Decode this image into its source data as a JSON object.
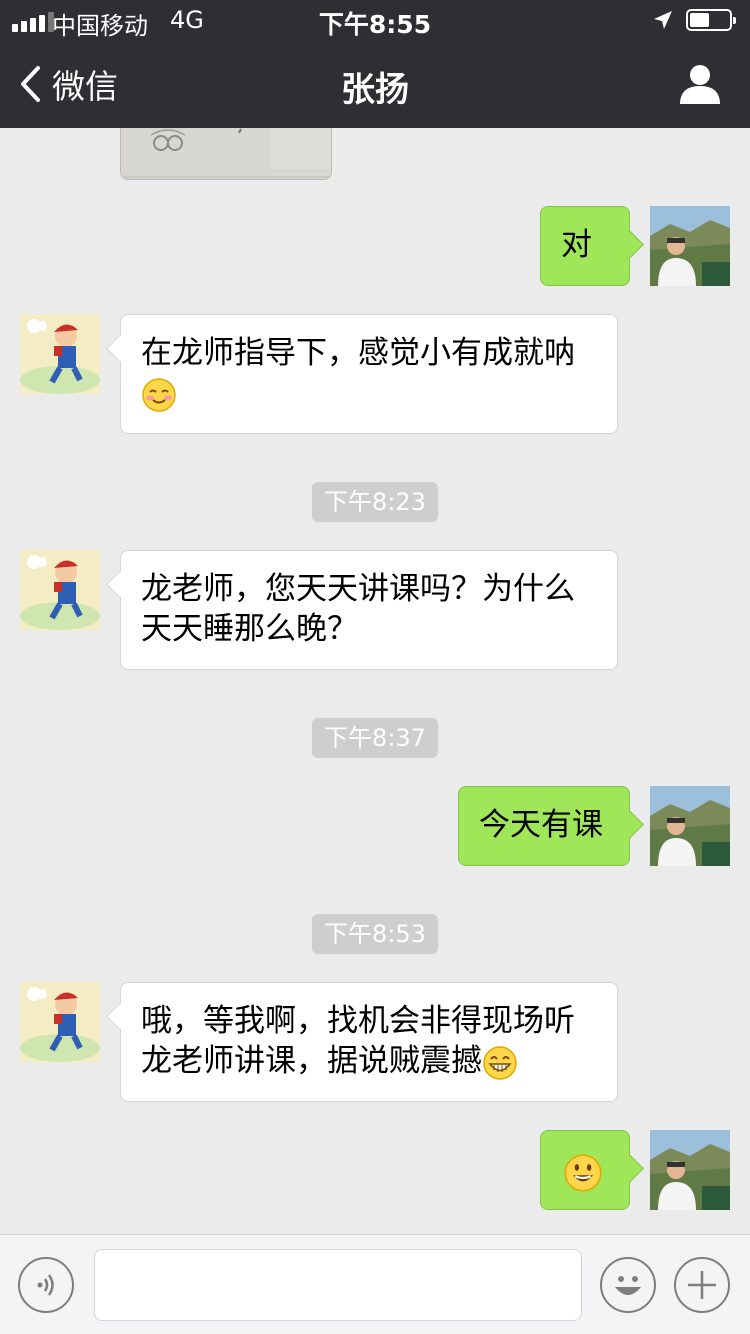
{
  "status_bar": {
    "carrier": "中国移动",
    "network": "4G",
    "time": "下午8:55",
    "battery_level": 0.5,
    "signal_bars": 4
  },
  "nav": {
    "back_label": "微信",
    "title": "张扬",
    "back_icon": "chevron-left-icon",
    "profile_icon": "person-icon"
  },
  "colors": {
    "header_bg": "#2e2e33",
    "chat_bg": "#ebebeb",
    "sent_bubble": "#9fe658",
    "received_bubble": "#ffffff",
    "timestamp_bg": "#cecece"
  },
  "messages": [
    {
      "type": "image",
      "sender": "contact"
    },
    {
      "type": "text",
      "sender": "me",
      "text": "对"
    },
    {
      "type": "text",
      "sender": "contact",
      "text": "在龙师指导下，感觉小有成就呐",
      "emoji": "blush-smile-emoji"
    },
    {
      "type": "timestamp",
      "text": "下午8:23"
    },
    {
      "type": "text",
      "sender": "contact",
      "text": "龙老师，您天天讲课吗？为什么天天睡那么晚？"
    },
    {
      "type": "timestamp",
      "text": "下午8:37"
    },
    {
      "type": "text",
      "sender": "me",
      "text": "今天有课"
    },
    {
      "type": "timestamp",
      "text": "下午8:53"
    },
    {
      "type": "text",
      "sender": "contact",
      "text": "哦，等我啊，找机会非得现场听龙老师讲课，据说贼震撼",
      "emoji": "grin-emoji"
    },
    {
      "type": "emoji",
      "sender": "me",
      "emoji": "smile-emoji"
    }
  ],
  "input_bar": {
    "voice_icon": "voice-icon",
    "emoji_icon": "emoji-face-icon",
    "plus_icon": "plus-icon",
    "placeholder": ""
  }
}
